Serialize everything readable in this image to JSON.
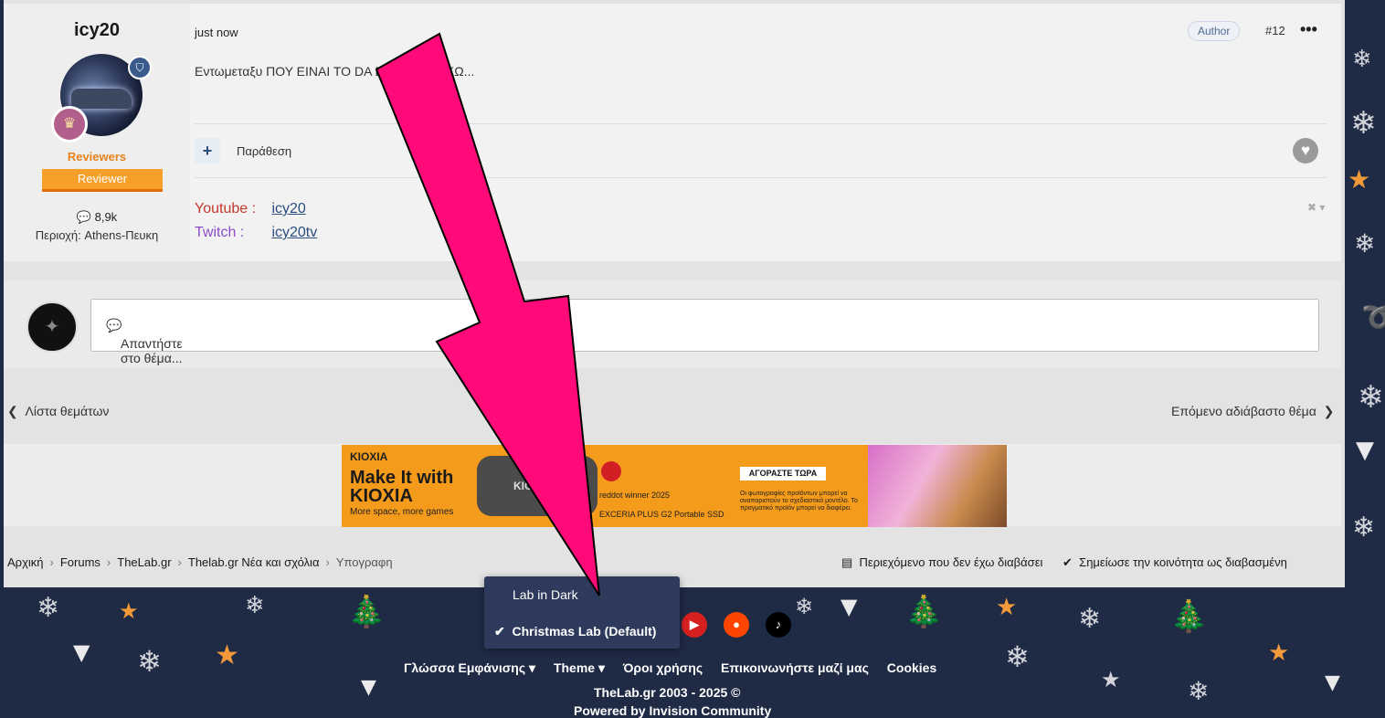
{
  "post": {
    "author_name": "icy20",
    "group_label": "Reviewers",
    "group_badge": "Reviewer",
    "post_count": "8,9k",
    "region": "Περιοχή: Athens-Πευκη",
    "time": "just now",
    "author_badge": "Author",
    "post_number": "#12",
    "more_icon": "•••",
    "body": "Εντωμεταξυ ΠΟΥ ΕΙΝΑΙ ΤΟ DA            ΕΝ ΤΟ ΒΡΙΣΚΩ...",
    "add_icon": "+",
    "quote_label": "Παράθεση",
    "signature": {
      "youtube_label": "Youtube :",
      "youtube_handle": "icy20",
      "twitch_label": "Twitch    :",
      "twitch_handle": "icy20tv",
      "close_icon": "✖ ▾"
    }
  },
  "reply": {
    "placeholder": "Απαντήστε στο θέμα..."
  },
  "navigation": {
    "prev_label": "Λίστα θεμάτων",
    "next_label": "Επόμενο αδιάβαστο θέμα"
  },
  "ad": {
    "brand": "KIOXIA",
    "headline": "Make It with KIOXIA",
    "sub": "More space, more games",
    "ssd_label": "KIO",
    "award": "reddot winner 2025",
    "product": "EXCERIA PLUS G2 Portable SSD",
    "cta": "ΑΓΟΡΑΣΤΕ ΤΩΡΑ",
    "disclaimer": "Οι φωτογραφίες προϊόντων μπορεί να αναπαριστούν το σχεδιαστικό μοντέλο. Το πραγματικό προϊόν μπορεί να διαφέρει."
  },
  "breadcrumb": {
    "items": [
      "Αρχική",
      "Forums",
      "TheLab.gr",
      "Thelab.gr Νέα και σχόλια"
    ],
    "current": "Υπογραφη",
    "separator": "›"
  },
  "actions": {
    "unread": "Περιεχόμενο που δεν έχω διαβάσει",
    "mark_read": "Σημείωσε την κοινότητα ως διαβασμένη"
  },
  "theme_menu": {
    "option1": "Lab in Dark",
    "option2": "Christmas Lab (Default)"
  },
  "footer": {
    "language": "Γλώσσα Εμφάνισης ▾",
    "theme": "Theme ▾",
    "terms": "Όροι χρήσης",
    "contact": "Επικοινωνήστε μαζί μας",
    "cookies": "Cookies",
    "copyright": "TheLab.gr 2003 - 2025 ©",
    "powered": "Powered by Invision Community"
  },
  "colors": {
    "accent_pink": "#ff0a78",
    "link": "#2b4c7e",
    "reviewer_orange": "#f6a02a",
    "footer_bg": "#1f2a44"
  }
}
